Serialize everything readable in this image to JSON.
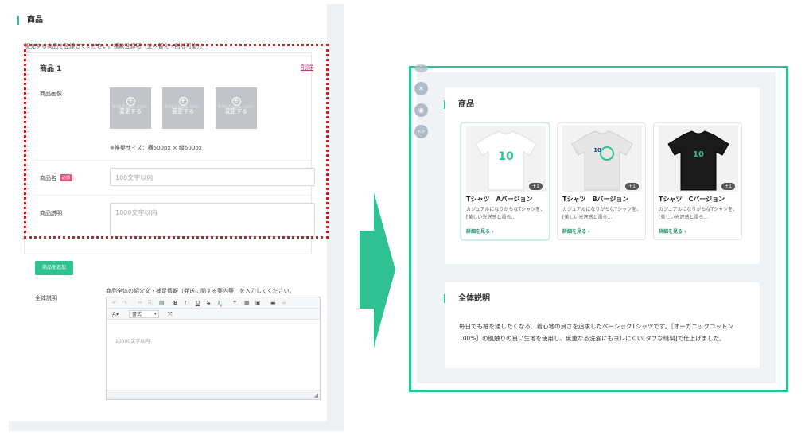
{
  "form": {
    "section_title": "商品",
    "instruction": "販売する商品を登録してください。複数登録可（並べ替え・削除可能）。",
    "product_label": "商品 1",
    "delete_label": "削除",
    "image_label": "商品画像",
    "change_label": "変更する",
    "image_watermark": "®Mutable.com",
    "size_hint": "※推奨サイズ：横500px × 縦500px",
    "name_label": "商品名",
    "required_badge": "必須",
    "name_placeholder": "100文字以内",
    "desc_label": "商品説明",
    "desc_placeholder": "1000文字以内",
    "add_button": "商品を追加",
    "overall_label": "全体説明",
    "overall_intro": "商品全体の紹介文・補足情報（発送に関する案内等）を入力してください。",
    "format_select": "書式",
    "editor_placeholder": "10000文字以内"
  },
  "preview": {
    "section_title": "商品",
    "products": [
      {
        "name": "Tシャツ　Aバージョン",
        "desc": "カジュアルになりがちなTシャツを、[美しい光沢感と滑ら…",
        "badge": "+1",
        "link": "詳細を見る ›",
        "shirt_color": "#ffffff"
      },
      {
        "name": "Tシャツ　Bバージョン",
        "desc": "カジュアルになりがちなTシャツを、[美しい光沢感と滑ら…",
        "badge": "+1",
        "link": "詳細を見る ›",
        "shirt_color": "#e6e6e6"
      },
      {
        "name": "Tシャツ　Cバージョン",
        "desc": "カジュアルになりがちなTシャツを、[美しい光沢感と滑ら…",
        "badge": "+1",
        "link": "詳細を見る ›",
        "shirt_color": "#1a1a1a"
      }
    ],
    "overall_title": "全体説明",
    "overall_text": "毎日でも袖を通したくなる、着心地の良さを追求したベーシックTシャツです。［オーガニックコットン100%］の肌触りの良い生地を使用し、度重なる洗濯にもヨレにくい[タフな縫製]で仕上げました。"
  },
  "colors": {
    "accent": "#2fc192",
    "highlight": "#cc1f1f",
    "delete": "#c4377d"
  }
}
